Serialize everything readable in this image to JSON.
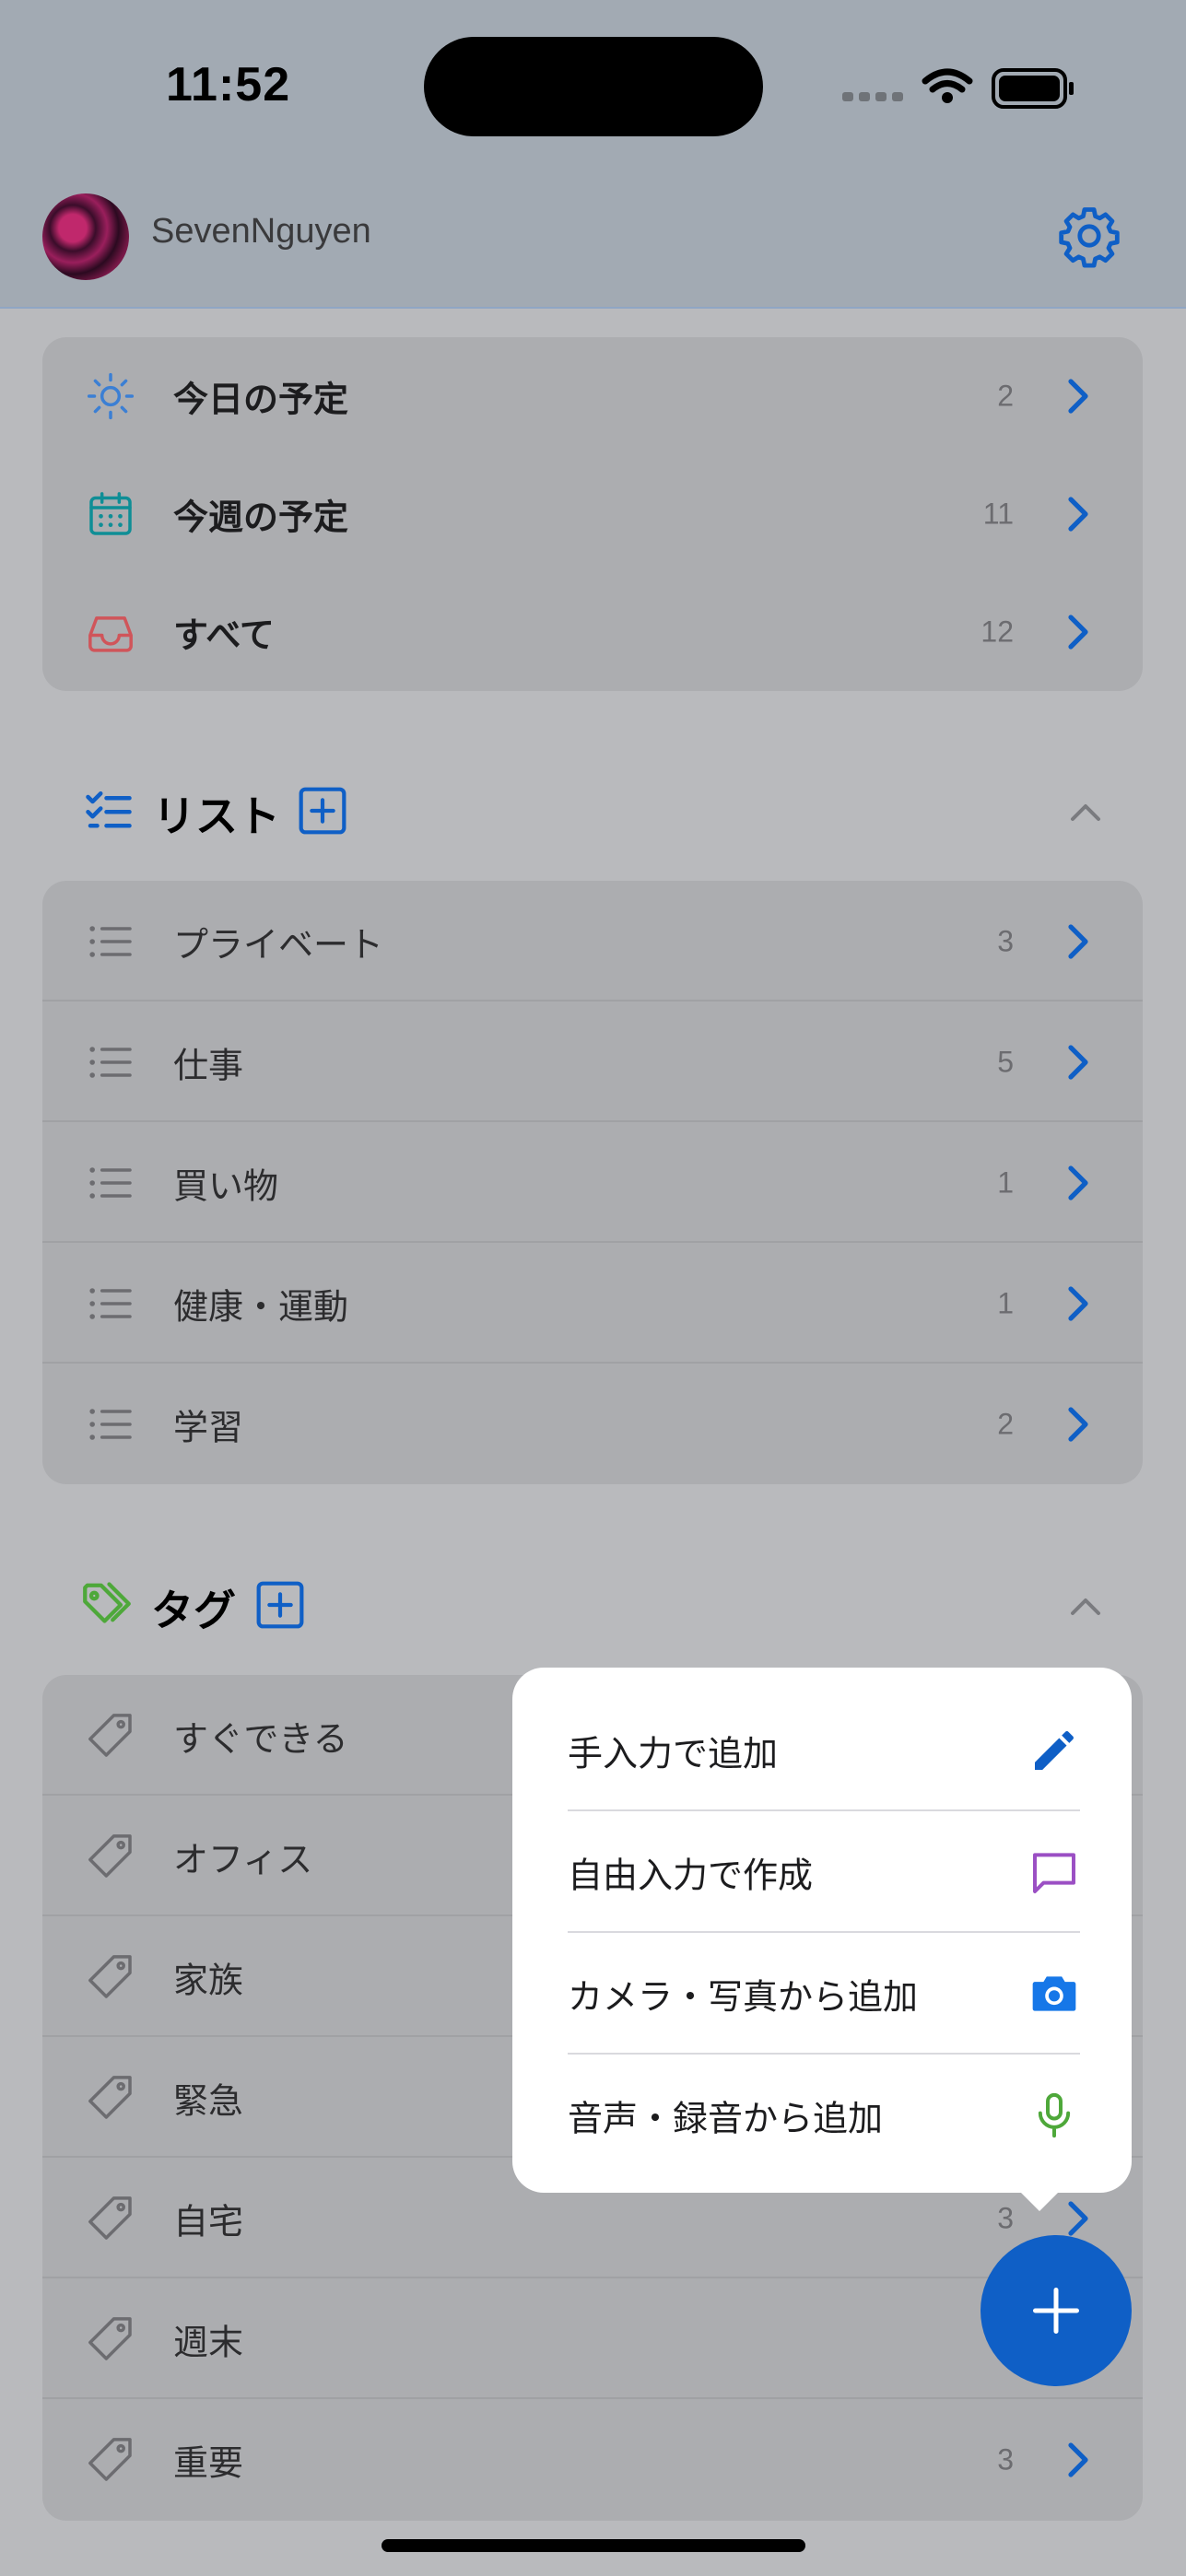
{
  "status_bar": {
    "time": "11:52"
  },
  "header": {
    "username": "SevenNguyen"
  },
  "smart_lists": [
    {
      "label": "今日の予定",
      "count": "2",
      "icon": "sun-icon",
      "color": "#3b7fd4"
    },
    {
      "label": "今週の予定",
      "count": "11",
      "icon": "calendar-icon",
      "color": "#0f8e96"
    },
    {
      "label": "すべて",
      "count": "12",
      "icon": "inbox-icon",
      "color": "#d0555a"
    }
  ],
  "lists_section": {
    "title": "リスト",
    "items": [
      {
        "label": "プライベート",
        "count": "3"
      },
      {
        "label": "仕事",
        "count": "5"
      },
      {
        "label": "買い物",
        "count": "1"
      },
      {
        "label": "健康・運動",
        "count": "1"
      },
      {
        "label": "学習",
        "count": "2"
      }
    ]
  },
  "tags_section": {
    "title": "タグ",
    "items": [
      {
        "label": "すぐできる",
        "count": ""
      },
      {
        "label": "オフィス",
        "count": ""
      },
      {
        "label": "家族",
        "count": ""
      },
      {
        "label": "緊急",
        "count": ""
      },
      {
        "label": "自宅",
        "count": "3"
      },
      {
        "label": "週末",
        "count": ""
      },
      {
        "label": "重要",
        "count": "3"
      }
    ]
  },
  "add_menu": {
    "items": [
      {
        "label": "手入力で追加",
        "icon": "pencil-icon",
        "color": "#0f5fc6"
      },
      {
        "label": "自由入力で作成",
        "icon": "chat-bubble-icon",
        "color": "#9b4fc4"
      },
      {
        "label": "カメラ・写真から追加",
        "icon": "camera-icon",
        "color": "#1677e8"
      },
      {
        "label": "音声・録音から追加",
        "icon": "microphone-icon",
        "color": "#4ea83a"
      }
    ]
  },
  "colors": {
    "accent": "#0f5fc6",
    "tag_green": "#4ea83a",
    "overlay_bg": "#b9babd"
  }
}
